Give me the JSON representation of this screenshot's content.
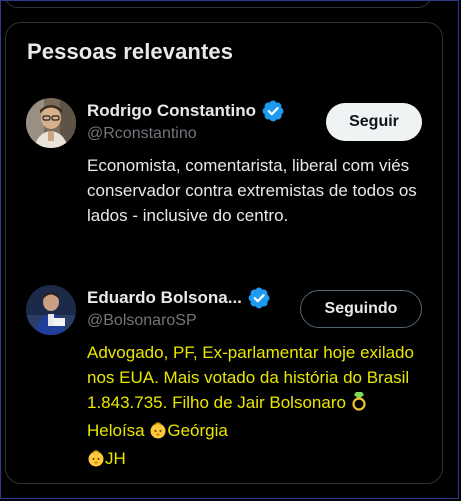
{
  "panel": {
    "title": "Pessoas relevantes"
  },
  "people": [
    {
      "name": "Rodrigo Constantino",
      "handle": "@Rconstantino",
      "verified": true,
      "button_label": "Seguir",
      "bio": "Economista, comentarista, liberal com viés conservador contra extremistas de todos os lados - inclusive do centro."
    },
    {
      "name": "Eduardo Bolsona...",
      "handle": "@BolsonaroSP",
      "verified": true,
      "button_label": "Seguindo",
      "bio_parts": {
        "text_main": "Advogado, PF, Ex-parlamentar hoje exilado nos EUA. Mais votado da história do Brasil 1.843.735. Filho de Jair Bolsonaro ",
        "text_heloisa": " Heloísa ",
        "text_georgia": "Geórgia",
        "text_jh": "JH"
      }
    }
  ],
  "colors": {
    "background": "#000000",
    "verified_badge": "#1d9bf0",
    "text_primary": "#e7e9ea",
    "text_secondary": "#71767b",
    "bio_highlight": "#e9e600",
    "border": "#2f3336"
  },
  "icons": {
    "verified": "verified-badge-icon",
    "ring": "ring-emoji-icon",
    "baby": "baby-emoji-icon"
  }
}
